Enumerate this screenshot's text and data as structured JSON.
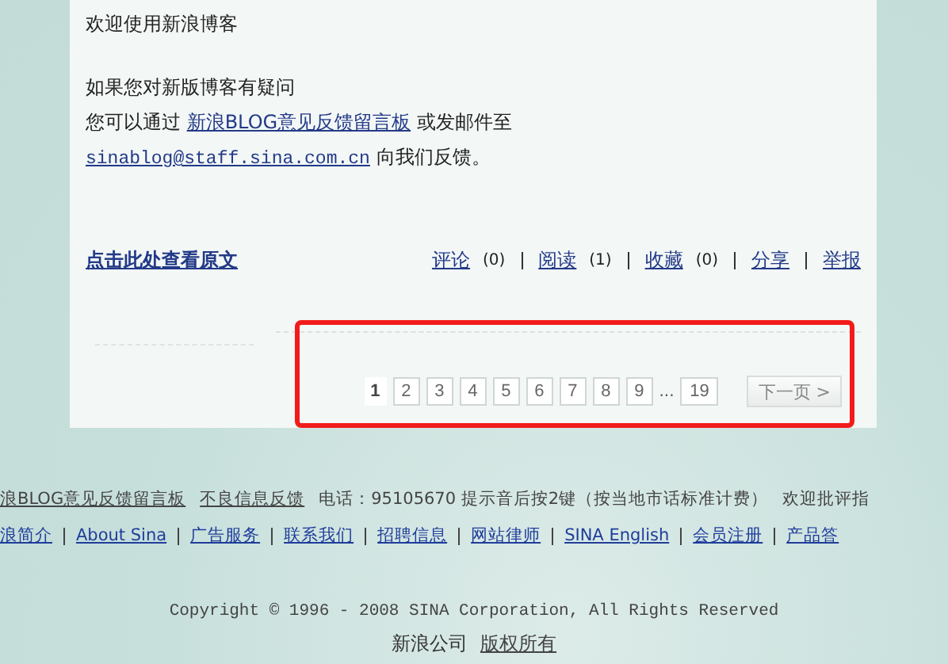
{
  "post": {
    "greeting": "欢迎使用新浪博客",
    "question": "如果您对新版博客有疑问",
    "contact_before": "您可以通过",
    "contact_link": "新浪BLOG意见反馈留言板",
    "contact_after": "或发邮件至",
    "email": "sinablog@staff.sina.com.cn",
    "email_after": "向我们反馈。"
  },
  "view_original": "点击此处查看原文",
  "actions": [
    {
      "label": "评论",
      "count": "(0)"
    },
    {
      "label": "阅读",
      "count": "(1)"
    },
    {
      "label": "收藏",
      "count": "(0)"
    },
    {
      "label": "分享"
    },
    {
      "label": "举报"
    }
  ],
  "pagination": {
    "pages": [
      {
        "label": "1",
        "selected": true
      },
      {
        "label": "2",
        "selected": false
      },
      {
        "label": "3",
        "selected": false
      },
      {
        "label": "4",
        "selected": false
      },
      {
        "label": "5",
        "selected": false
      },
      {
        "label": "6",
        "selected": false
      },
      {
        "label": "7",
        "selected": false
      },
      {
        "label": "8",
        "selected": false
      },
      {
        "label": "9",
        "selected": false
      },
      {
        "label": "...",
        "kind": "ellipsis"
      },
      {
        "label": "19",
        "selected": false
      }
    ],
    "next": "下一页 >"
  },
  "footer": {
    "feedback_links": [
      "浪BLOG意见反馈留言板",
      "不良信息反馈"
    ],
    "phone": "电话：95105670 提示音后按2键（按当地市话标准计费）",
    "welcome": "欢迎批评指",
    "nav": [
      "浪简介",
      "About Sina",
      "广告服务",
      "联系我们",
      "招聘信息",
      "网站律师",
      "SINA English",
      "会员注册",
      "产品答"
    ],
    "copyright": "Copyright © 1996 - 2008 SINA Corporation, All Rights Reserved",
    "company": "新浪公司",
    "rights": "版权所有"
  }
}
